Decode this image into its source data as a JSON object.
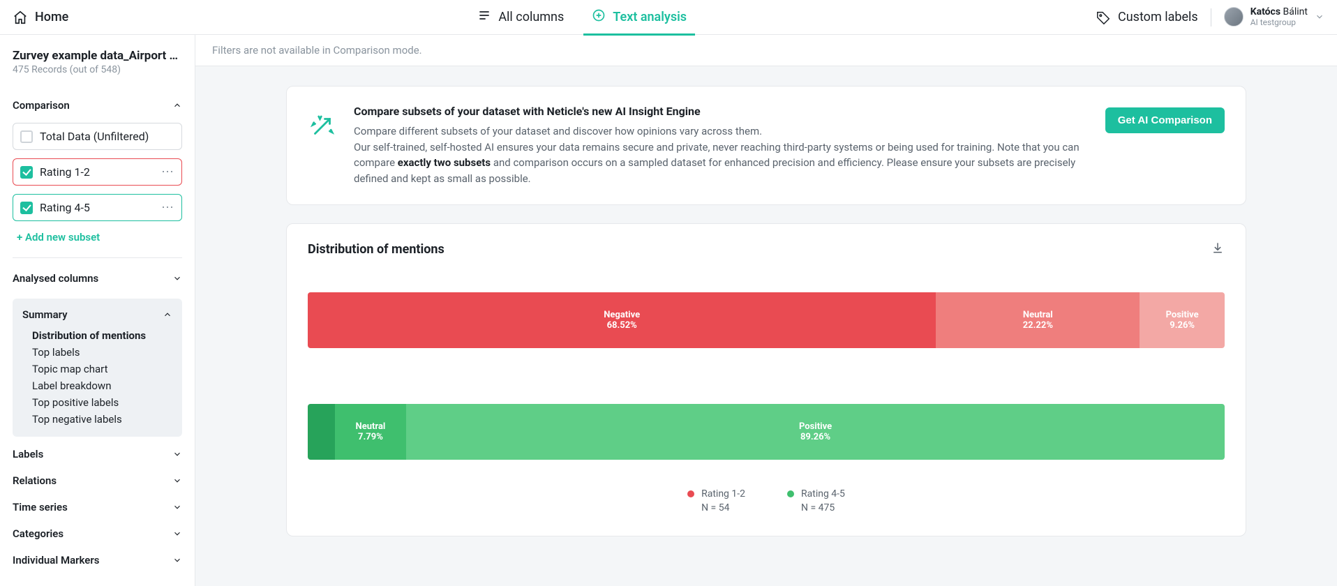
{
  "topbar": {
    "home": "Home",
    "tabs": {
      "all_columns": "All columns",
      "text_analysis": "Text analysis"
    },
    "custom_labels": "Custom labels",
    "user": {
      "name_first": "Katócs",
      "name_last": "Bálint",
      "group": "AI testgroup"
    }
  },
  "sidebar": {
    "dataset_title": "Zurvey example data_Airport …",
    "dataset_sub": "475 Records (out of 548)",
    "comparison": {
      "heading": "Comparison",
      "subsets": [
        {
          "label": "Total Data (Unfiltered)",
          "checked": false,
          "variant": "plain"
        },
        {
          "label": "Rating 1-2",
          "checked": true,
          "variant": "red"
        },
        {
          "label": "Rating 4-5",
          "checked": true,
          "variant": "green"
        }
      ],
      "add_label": "+ Add new subset"
    },
    "analysed_columns": "Analysed columns",
    "summary": {
      "heading": "Summary",
      "items": [
        {
          "label": "Distribution of mentions",
          "active": true
        },
        {
          "label": "Top labels",
          "active": false
        },
        {
          "label": "Topic map chart",
          "active": false
        },
        {
          "label": "Label breakdown",
          "active": false
        },
        {
          "label": "Top positive labels",
          "active": false
        },
        {
          "label": "Top negative labels",
          "active": false
        }
      ]
    },
    "nav": [
      "Labels",
      "Relations",
      "Time series",
      "Categories",
      "Individual Markers"
    ]
  },
  "content": {
    "filters_note": "Filters are not available in Comparison mode.",
    "banner": {
      "title": "Compare subsets of your dataset with Neticle's new AI Insight Engine",
      "text_pre": "Compare different subsets of your dataset and discover how opinions vary across them.\nOur self-trained, self-hosted AI ensures your data remains secure and private, never reaching third-party systems or being used for training. Note that you can compare ",
      "text_bold": "exactly two subsets",
      "text_post": " and comparison occurs on a sampled dataset for enhanced precision and efficiency. Please ensure your subsets are precisely defined and kept as small as possible.",
      "button": "Get AI Comparison"
    },
    "card_title": "Distribution of mentions",
    "legend": [
      {
        "name": "Rating 1-2",
        "n": "N = 54",
        "color": "#e94b52"
      },
      {
        "name": "Rating 4-5",
        "n": "N = 475",
        "color": "#3fbf6e"
      }
    ]
  },
  "chart_data": [
    {
      "type": "bar",
      "orientation": "stacked-horizontal",
      "series_name": "Rating 1-2",
      "categories": [
        "Negative",
        "Neutral",
        "Positive"
      ],
      "values": [
        68.52,
        22.22,
        9.26
      ],
      "unit": "%",
      "colors": [
        "#e94b52",
        "#ef7e7d",
        "#f3a8a5"
      ]
    },
    {
      "type": "bar",
      "orientation": "stacked-horizontal",
      "series_name": "Rating 4-5",
      "categories": [
        "Negative",
        "Neutral",
        "Positive"
      ],
      "values": [
        2.95,
        7.79,
        89.26
      ],
      "unit": "%",
      "colors": [
        "#27a35a",
        "#3fbf6e",
        "#5fce87"
      ],
      "hidden_labels": [
        "Negative"
      ]
    }
  ]
}
